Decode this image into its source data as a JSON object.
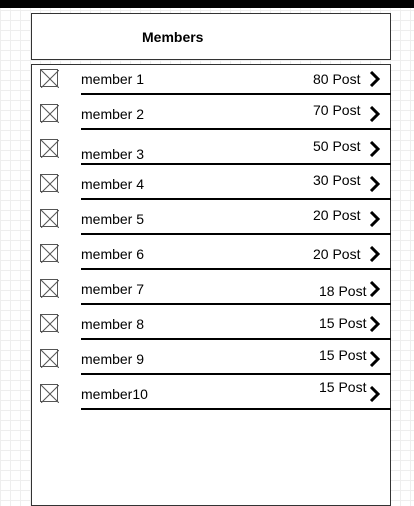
{
  "header": {
    "title": "Members"
  },
  "members": [
    {
      "name": "member 1",
      "posts": "80 Post"
    },
    {
      "name": "member 2",
      "posts": "70 Post"
    },
    {
      "name": "member 3",
      "posts": "50 Post"
    },
    {
      "name": "member 4",
      "posts": "30 Post"
    },
    {
      "name": "member 5",
      "posts": "20 Post"
    },
    {
      "name": "member 6",
      "posts": "20 Post"
    },
    {
      "name": "member 7",
      "posts": "18 Post"
    },
    {
      "name": "member 8",
      "posts": "15 Post"
    },
    {
      "name": "member 9",
      "posts": "15 Post"
    },
    {
      "name": "member10",
      "posts": "15 Post"
    }
  ]
}
